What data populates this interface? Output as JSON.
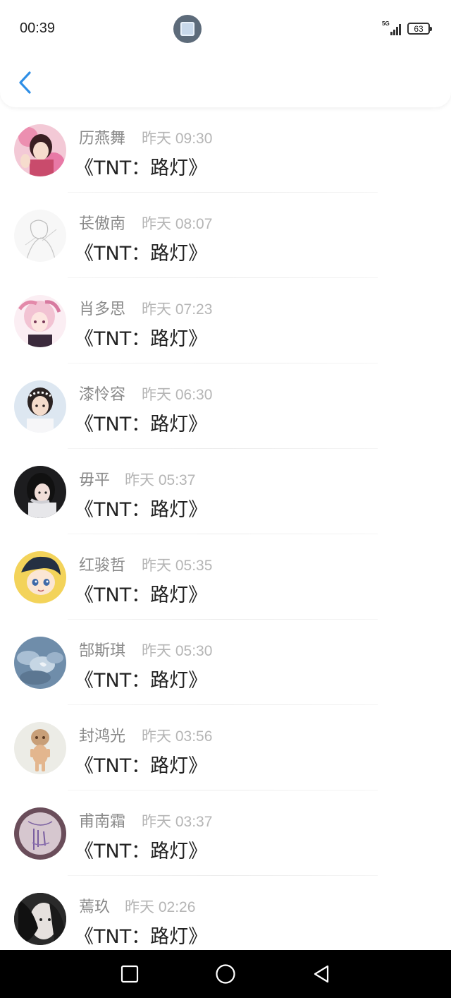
{
  "status_bar": {
    "time": "00:39",
    "network": "5G",
    "battery": "63"
  },
  "nav": {
    "back_icon": "chevron-left-icon",
    "accent_color": "#2f8fe6"
  },
  "messages": [
    {
      "name": "历燕舞",
      "time": "昨天 09:30",
      "text": "《TNT：路灯》"
    },
    {
      "name": "苌傲南",
      "time": "昨天 08:07",
      "text": "《TNT：路灯》"
    },
    {
      "name": "肖多思",
      "time": "昨天 07:23",
      "text": "《TNT：路灯》"
    },
    {
      "name": "漆怜容",
      "time": "昨天 06:30",
      "text": "《TNT：路灯》"
    },
    {
      "name": "毋平",
      "time": "昨天 05:37",
      "text": "《TNT：路灯》"
    },
    {
      "name": "红骏哲",
      "time": "昨天 05:35",
      "text": "《TNT：路灯》"
    },
    {
      "name": "郜斯琪",
      "time": "昨天 05:30",
      "text": "《TNT：路灯》"
    },
    {
      "name": "封鸿光",
      "time": "昨天 03:56",
      "text": "《TNT：路灯》"
    },
    {
      "name": "甫南霜",
      "time": "昨天 03:37",
      "text": "《TNT：路灯》"
    },
    {
      "name": "蔫玖",
      "time": "昨天 02:26",
      "text": "《TNT：路灯》"
    }
  ],
  "system_nav": {
    "recent_icon": "square-icon",
    "home_icon": "circle-icon",
    "back_icon": "triangle-back-icon"
  }
}
